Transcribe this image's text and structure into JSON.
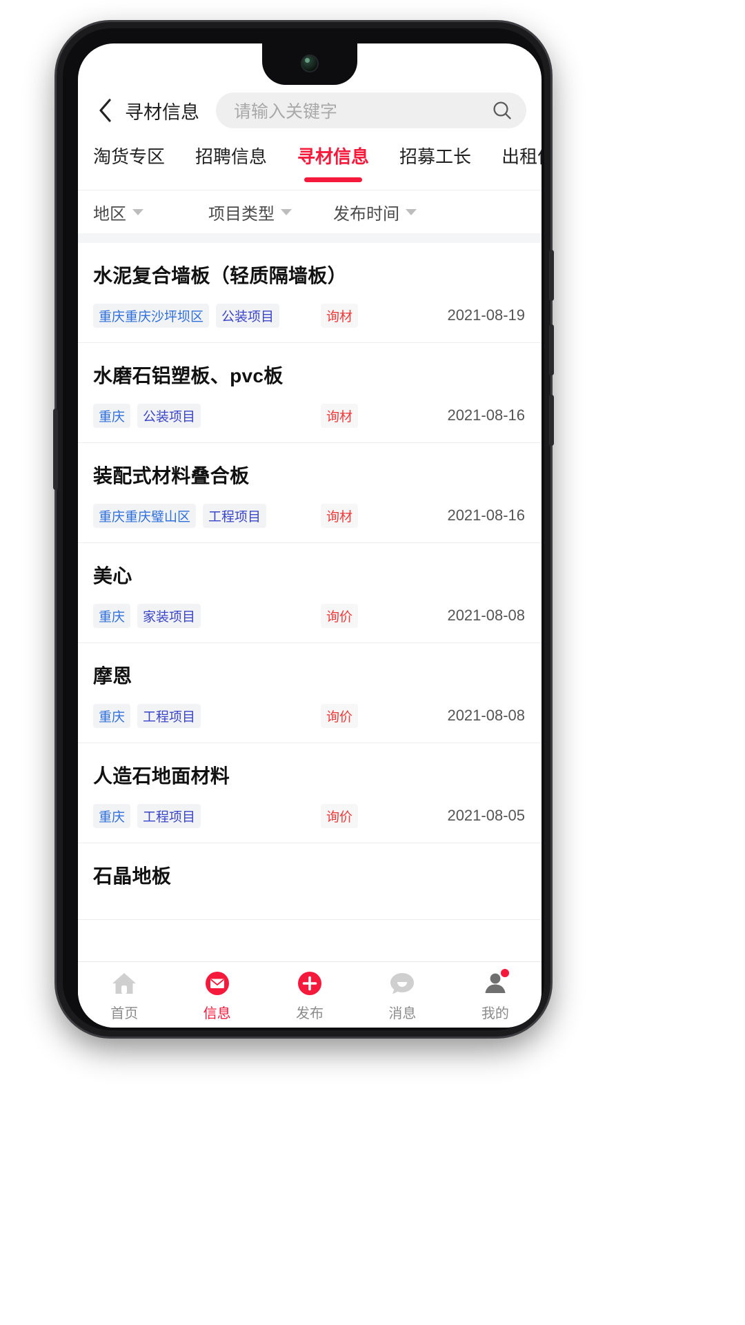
{
  "header": {
    "back_icon": "chevron-left-icon",
    "title": "寻材信息",
    "search_placeholder": "请输入关键字",
    "search_icon": "search-icon"
  },
  "tabs": [
    {
      "label": "淘货专区",
      "active": false
    },
    {
      "label": "招聘信息",
      "active": false
    },
    {
      "label": "寻材信息",
      "active": true
    },
    {
      "label": "招募工长",
      "active": false
    },
    {
      "label": "出租信息",
      "active": false
    }
  ],
  "filters": [
    {
      "label": "地区",
      "icon": "chevron-down-icon"
    },
    {
      "label": "项目类型",
      "icon": "chevron-down-icon"
    },
    {
      "label": "发布时间",
      "icon": "chevron-down-icon"
    }
  ],
  "list": [
    {
      "title": "水泥复合墙板（轻质隔墙板）",
      "region": "重庆重庆沙坪坝区",
      "type": "公装项目",
      "kind": "询材",
      "date": "2021-08-19"
    },
    {
      "title": "水磨石铝塑板、pvc板",
      "region": "重庆",
      "type": "公装项目",
      "kind": "询材",
      "date": "2021-08-16"
    },
    {
      "title": "装配式材料叠合板",
      "region": "重庆重庆璧山区",
      "type": "工程项目",
      "kind": "询材",
      "date": "2021-08-16"
    },
    {
      "title": "美心",
      "region": "重庆",
      "type": "家装项目",
      "kind": "询价",
      "date": "2021-08-08"
    },
    {
      "title": "摩恩",
      "region": "重庆",
      "type": "工程项目",
      "kind": "询价",
      "date": "2021-08-08"
    },
    {
      "title": "人造石地面材料",
      "region": "重庆",
      "type": "工程项目",
      "kind": "询价",
      "date": "2021-08-05"
    },
    {
      "title": "石晶地板",
      "region": "",
      "type": "",
      "kind": "",
      "date": ""
    }
  ],
  "bottom_nav": [
    {
      "label": "首页",
      "icon": "home-icon",
      "active": false,
      "badge": false
    },
    {
      "label": "信息",
      "icon": "envelope-icon",
      "active": true,
      "badge": false
    },
    {
      "label": "发布",
      "icon": "plus-circle-icon",
      "active": false,
      "badge": false
    },
    {
      "label": "消息",
      "icon": "chat-bubble-icon",
      "active": false,
      "badge": false
    },
    {
      "label": "我的",
      "icon": "person-icon",
      "active": false,
      "badge": true
    }
  ],
  "colors": {
    "accent": "#f5193c",
    "region_tag": "#2f6fdb",
    "type_tag": "#3a44c8",
    "kind_tag": "#ef3b3b",
    "muted": "#8b8b8b"
  }
}
